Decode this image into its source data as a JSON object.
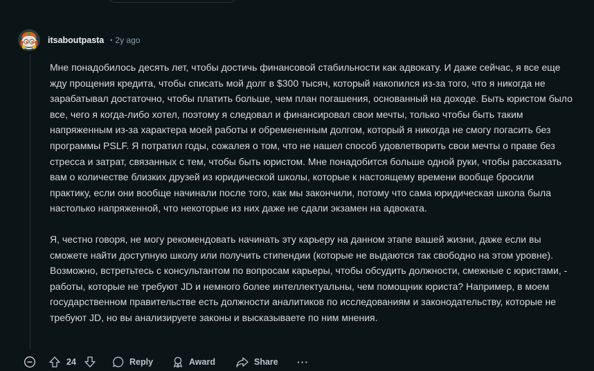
{
  "comment": {
    "username": "itsaboutpasta",
    "separator": "•",
    "timestamp": "2y ago",
    "paragraphs": [
      "Мне понадобилось десять лет, чтобы достичь финансовой стабильности как адвокату. И даже сейчас, я все еще жду прощения кредита, чтобы списать мой долг в $300 тысяч, который накопился из-за того, что я никогда не зарабатывал достаточно, чтобы платить больше, чем план погашения, основанный на доходе. Быть юристом было все, чего я когда-либо хотел, поэтому я следовал и финансировал свои мечты, только чтобы быть таким напряженным из-за характера моей работы и обремененным долгом, который я никогда не смогу погасить без программы PSLF. Я потратил годы, сожалея о том, что не нашел способ удовлетворить свои мечты о праве без стресса и затрат, связанных с тем, чтобы быть юристом. Мне понадобится больше одной руки, чтобы рассказать вам о количестве близких друзей из юридической школы, которые к настоящему времени вообще бросили практику, если они вообще начинали после того, как мы закончили, потому что сама юридическая школа была настолько напряженной, что некоторые из них даже не сдали экзамен на адвоката.",
      "Я, честно говоря, не могу рекомендовать начинать эту карьеру на данном этапе вашей жизни, даже если вы сможете найти доступную школу или получить стипендии (которые не выдаются так свободно на этом уровне). Возможно, встретьтесь с консультантом по вопросам карьеры, чтобы обсудить должности, смежные с юристами, - работы, которые не требуют JD и немного более интеллектуальны, чем помощник юриста? Например, в моем государственном правительстве есть должности аналитиков по исследованиям и законодательству, которые не требуют JD, но вы анализируете законы и высказываете по ним мнения."
    ]
  },
  "actions": {
    "collapse_icon": "collapse-minus-icon",
    "upvote_icon": "upvote-arrow-icon",
    "vote_count": "24",
    "downvote_icon": "downvote-arrow-icon",
    "reply_label": "Reply",
    "award_label": "Award",
    "share_label": "Share",
    "more_label": "···"
  },
  "colors": {
    "background": "#0b1416",
    "text": "#d7dadc",
    "username": "#eef1f3",
    "meta": "#8ba2ad",
    "action": "#b8c5c9"
  }
}
